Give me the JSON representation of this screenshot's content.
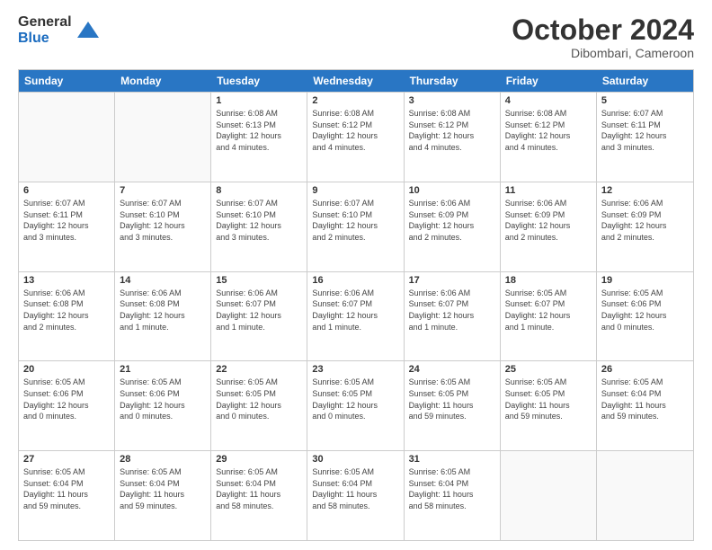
{
  "logo": {
    "general": "General",
    "blue": "Blue"
  },
  "title": "October 2024",
  "subtitle": "Dibombari, Cameroon",
  "header_days": [
    "Sunday",
    "Monday",
    "Tuesday",
    "Wednesday",
    "Thursday",
    "Friday",
    "Saturday"
  ],
  "weeks": [
    [
      {
        "day": "",
        "info": ""
      },
      {
        "day": "",
        "info": ""
      },
      {
        "day": "1",
        "info": "Sunrise: 6:08 AM\nSunset: 6:13 PM\nDaylight: 12 hours\nand 4 minutes."
      },
      {
        "day": "2",
        "info": "Sunrise: 6:08 AM\nSunset: 6:12 PM\nDaylight: 12 hours\nand 4 minutes."
      },
      {
        "day": "3",
        "info": "Sunrise: 6:08 AM\nSunset: 6:12 PM\nDaylight: 12 hours\nand 4 minutes."
      },
      {
        "day": "4",
        "info": "Sunrise: 6:08 AM\nSunset: 6:12 PM\nDaylight: 12 hours\nand 4 minutes."
      },
      {
        "day": "5",
        "info": "Sunrise: 6:07 AM\nSunset: 6:11 PM\nDaylight: 12 hours\nand 3 minutes."
      }
    ],
    [
      {
        "day": "6",
        "info": "Sunrise: 6:07 AM\nSunset: 6:11 PM\nDaylight: 12 hours\nand 3 minutes."
      },
      {
        "day": "7",
        "info": "Sunrise: 6:07 AM\nSunset: 6:10 PM\nDaylight: 12 hours\nand 3 minutes."
      },
      {
        "day": "8",
        "info": "Sunrise: 6:07 AM\nSunset: 6:10 PM\nDaylight: 12 hours\nand 3 minutes."
      },
      {
        "day": "9",
        "info": "Sunrise: 6:07 AM\nSunset: 6:10 PM\nDaylight: 12 hours\nand 2 minutes."
      },
      {
        "day": "10",
        "info": "Sunrise: 6:06 AM\nSunset: 6:09 PM\nDaylight: 12 hours\nand 2 minutes."
      },
      {
        "day": "11",
        "info": "Sunrise: 6:06 AM\nSunset: 6:09 PM\nDaylight: 12 hours\nand 2 minutes."
      },
      {
        "day": "12",
        "info": "Sunrise: 6:06 AM\nSunset: 6:09 PM\nDaylight: 12 hours\nand 2 minutes."
      }
    ],
    [
      {
        "day": "13",
        "info": "Sunrise: 6:06 AM\nSunset: 6:08 PM\nDaylight: 12 hours\nand 2 minutes."
      },
      {
        "day": "14",
        "info": "Sunrise: 6:06 AM\nSunset: 6:08 PM\nDaylight: 12 hours\nand 1 minute."
      },
      {
        "day": "15",
        "info": "Sunrise: 6:06 AM\nSunset: 6:07 PM\nDaylight: 12 hours\nand 1 minute."
      },
      {
        "day": "16",
        "info": "Sunrise: 6:06 AM\nSunset: 6:07 PM\nDaylight: 12 hours\nand 1 minute."
      },
      {
        "day": "17",
        "info": "Sunrise: 6:06 AM\nSunset: 6:07 PM\nDaylight: 12 hours\nand 1 minute."
      },
      {
        "day": "18",
        "info": "Sunrise: 6:05 AM\nSunset: 6:07 PM\nDaylight: 12 hours\nand 1 minute."
      },
      {
        "day": "19",
        "info": "Sunrise: 6:05 AM\nSunset: 6:06 PM\nDaylight: 12 hours\nand 0 minutes."
      }
    ],
    [
      {
        "day": "20",
        "info": "Sunrise: 6:05 AM\nSunset: 6:06 PM\nDaylight: 12 hours\nand 0 minutes."
      },
      {
        "day": "21",
        "info": "Sunrise: 6:05 AM\nSunset: 6:06 PM\nDaylight: 12 hours\nand 0 minutes."
      },
      {
        "day": "22",
        "info": "Sunrise: 6:05 AM\nSunset: 6:05 PM\nDaylight: 12 hours\nand 0 minutes."
      },
      {
        "day": "23",
        "info": "Sunrise: 6:05 AM\nSunset: 6:05 PM\nDaylight: 12 hours\nand 0 minutes."
      },
      {
        "day": "24",
        "info": "Sunrise: 6:05 AM\nSunset: 6:05 PM\nDaylight: 11 hours\nand 59 minutes."
      },
      {
        "day": "25",
        "info": "Sunrise: 6:05 AM\nSunset: 6:05 PM\nDaylight: 11 hours\nand 59 minutes."
      },
      {
        "day": "26",
        "info": "Sunrise: 6:05 AM\nSunset: 6:04 PM\nDaylight: 11 hours\nand 59 minutes."
      }
    ],
    [
      {
        "day": "27",
        "info": "Sunrise: 6:05 AM\nSunset: 6:04 PM\nDaylight: 11 hours\nand 59 minutes."
      },
      {
        "day": "28",
        "info": "Sunrise: 6:05 AM\nSunset: 6:04 PM\nDaylight: 11 hours\nand 59 minutes."
      },
      {
        "day": "29",
        "info": "Sunrise: 6:05 AM\nSunset: 6:04 PM\nDaylight: 11 hours\nand 58 minutes."
      },
      {
        "day": "30",
        "info": "Sunrise: 6:05 AM\nSunset: 6:04 PM\nDaylight: 11 hours\nand 58 minutes."
      },
      {
        "day": "31",
        "info": "Sunrise: 6:05 AM\nSunset: 6:04 PM\nDaylight: 11 hours\nand 58 minutes."
      },
      {
        "day": "",
        "info": ""
      },
      {
        "day": "",
        "info": ""
      }
    ]
  ]
}
